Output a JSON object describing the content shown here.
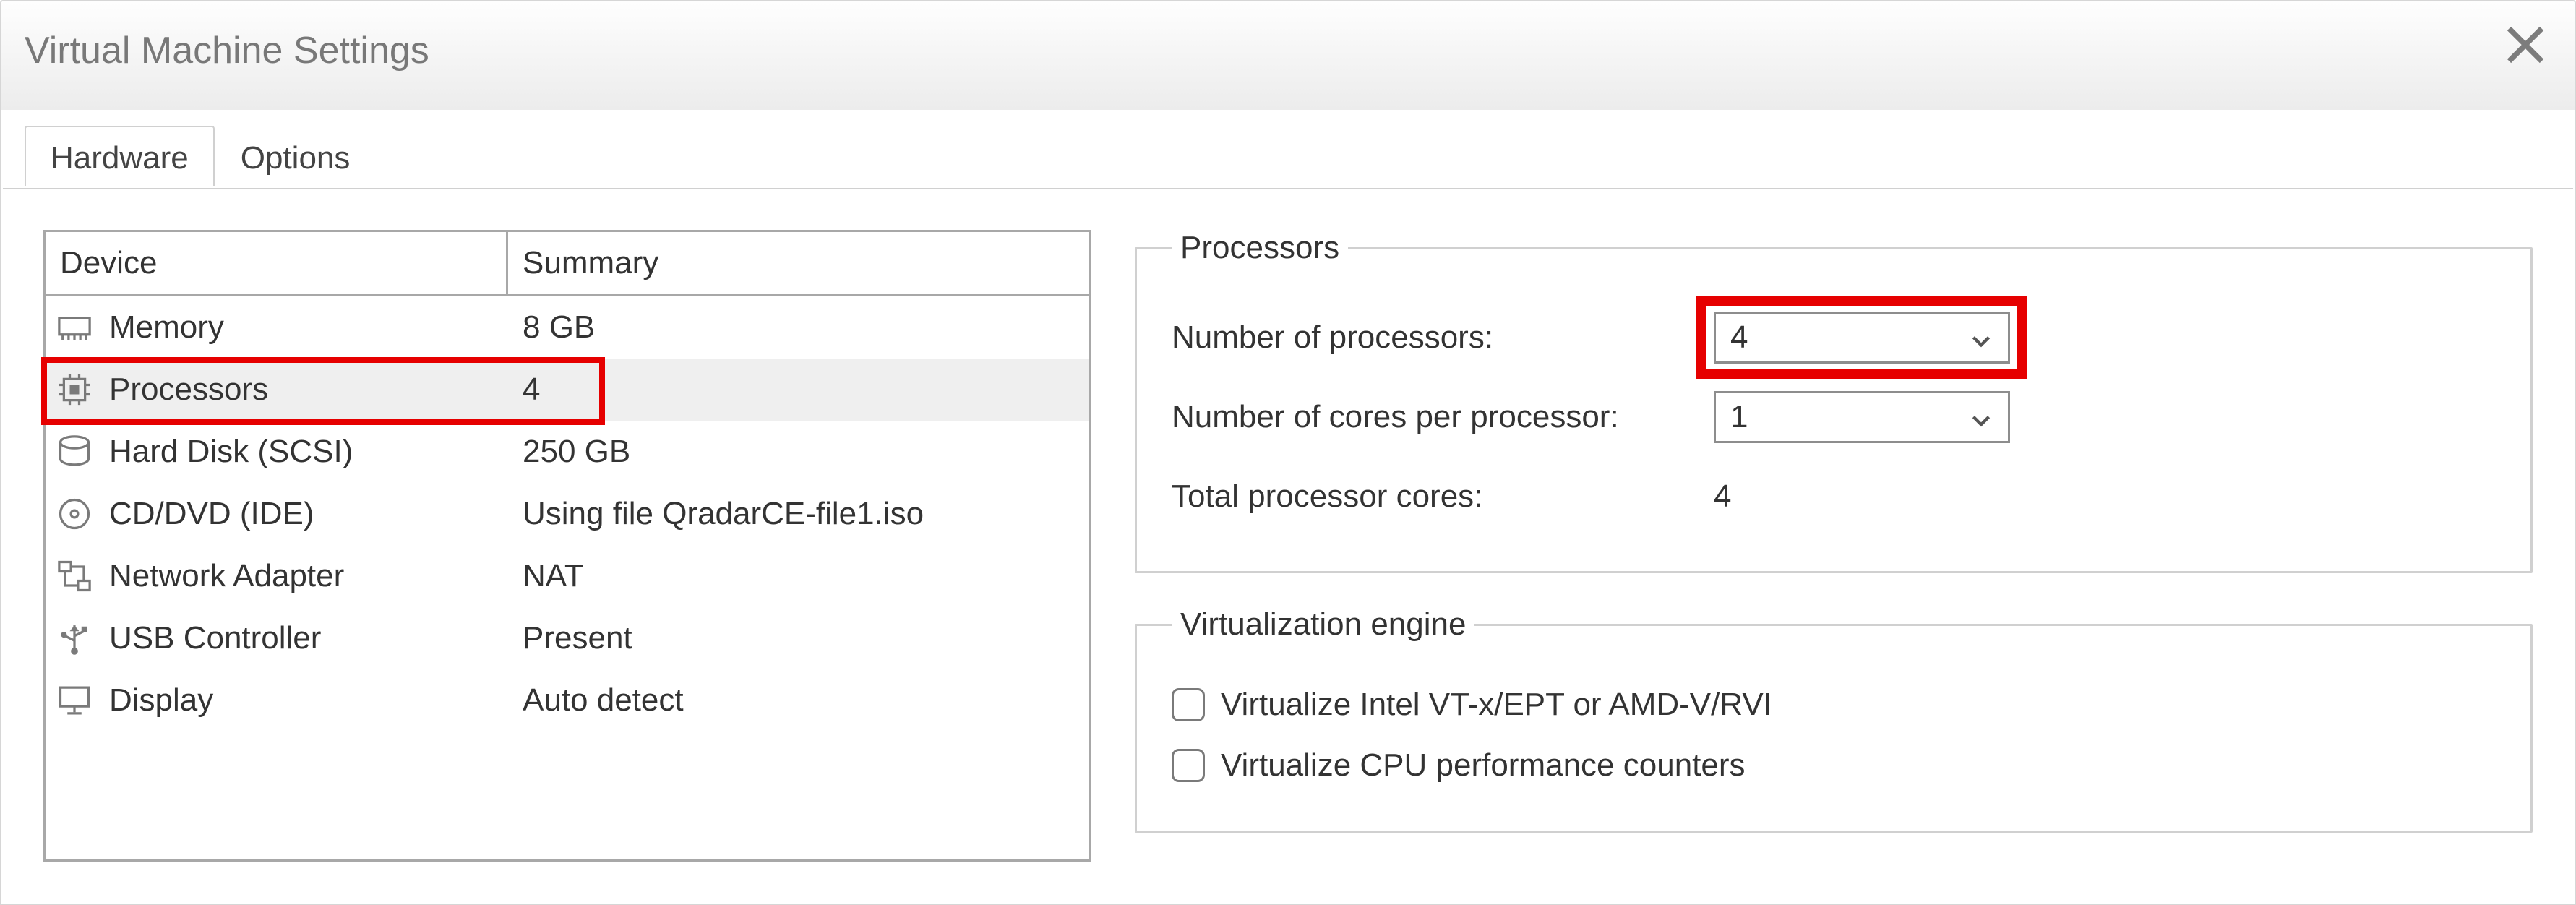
{
  "window": {
    "title": "Virtual Machine Settings"
  },
  "tabs": {
    "hardware": "Hardware",
    "options": "Options",
    "active": "hardware"
  },
  "device_table": {
    "headers": {
      "device": "Device",
      "summary": "Summary"
    },
    "rows": [
      {
        "icon": "memory",
        "name": "Memory",
        "summary": "8 GB"
      },
      {
        "icon": "cpu",
        "name": "Processors",
        "summary": "4"
      },
      {
        "icon": "disk",
        "name": "Hard Disk (SCSI)",
        "summary": "250 GB"
      },
      {
        "icon": "cd",
        "name": "CD/DVD (IDE)",
        "summary": "Using file QradarCE-file1.iso"
      },
      {
        "icon": "net",
        "name": "Network Adapter",
        "summary": "NAT"
      },
      {
        "icon": "usb",
        "name": "USB Controller",
        "summary": "Present"
      },
      {
        "icon": "display",
        "name": "Display",
        "summary": "Auto detect"
      }
    ],
    "selected_index": 1
  },
  "processors": {
    "legend": "Processors",
    "num_proc_label": "Number of processors:",
    "num_proc_value": "4",
    "cores_label": "Number of cores per processor:",
    "cores_value": "1",
    "total_label": "Total processor cores:",
    "total_value": "4"
  },
  "virt_engine": {
    "legend": "Virtualization engine",
    "opt1": "Virtualize Intel VT-x/EPT or AMD-V/RVI",
    "opt2": "Virtualize CPU performance counters",
    "opt1_checked": false,
    "opt2_checked": false
  }
}
